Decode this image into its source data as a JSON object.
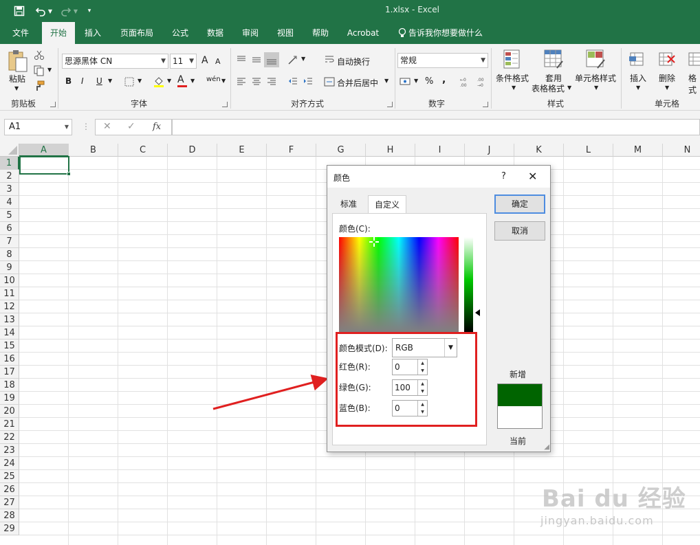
{
  "window": {
    "title": "1.xlsx  -  Excel"
  },
  "tabs": [
    "文件",
    "开始",
    "插入",
    "页面布局",
    "公式",
    "数据",
    "审阅",
    "视图",
    "帮助",
    "Acrobat"
  ],
  "tell_me": "告诉我你想要做什么",
  "ribbon": {
    "clipboard": {
      "paste": "粘贴",
      "label": "剪贴板"
    },
    "font": {
      "name": "思源黑体 CN",
      "size": "11",
      "label": "字体",
      "bold": "B",
      "italic": "I",
      "underline": "U",
      "grow": "A",
      "shrink": "A",
      "phonetic": "wén"
    },
    "alignment": {
      "wrap": "自动换行",
      "merge": "合并后居中",
      "label": "对齐方式"
    },
    "number": {
      "format": "常规",
      "percent": "%",
      "comma": ",",
      "label": "数字"
    },
    "styles": {
      "conditional": "条件格式",
      "table_line1": "套用",
      "table_line2": "表格格式",
      "cell_styles": "单元格样式",
      "label": "样式"
    },
    "cells": {
      "insert": "插入",
      "delete": "删除",
      "format": "格式",
      "label": "单元格"
    }
  },
  "formula_bar": {
    "name_box": "A1",
    "fx": "fx",
    "value": ""
  },
  "grid": {
    "columns": [
      "A",
      "B",
      "C",
      "D",
      "E",
      "F",
      "G",
      "H",
      "I",
      "J",
      "K",
      "L",
      "M",
      "N"
    ],
    "rows": [
      "1",
      "2",
      "3",
      "4",
      "5",
      "6",
      "7",
      "8",
      "9",
      "10",
      "11",
      "12",
      "13",
      "14",
      "15",
      "16",
      "17",
      "18",
      "19",
      "20",
      "21",
      "22",
      "23",
      "24",
      "25",
      "26",
      "27",
      "28",
      "29"
    ],
    "active_cell": "A1"
  },
  "dialog": {
    "title": "颜色",
    "help": "?",
    "tabs": {
      "standard": "标准",
      "custom": "自定义"
    },
    "colors_label": "颜色(C):",
    "mode_label": "颜色模式(D):",
    "mode_value": "RGB",
    "red_label": "红色(R):",
    "red_value": "0",
    "green_label": "绿色(G):",
    "green_value": "100",
    "blue_label": "蓝色(B):",
    "blue_value": "0",
    "ok": "确定",
    "cancel": "取消",
    "new_label": "新增",
    "current_label": "当前",
    "new_color": "#006400",
    "current_color": "#ffffff"
  },
  "watermark": {
    "brand": "Bai du 经验",
    "url": "jingyan.baidu.com"
  },
  "colors": {
    "excel_green": "#217346",
    "annotation_red": "#e02020"
  }
}
